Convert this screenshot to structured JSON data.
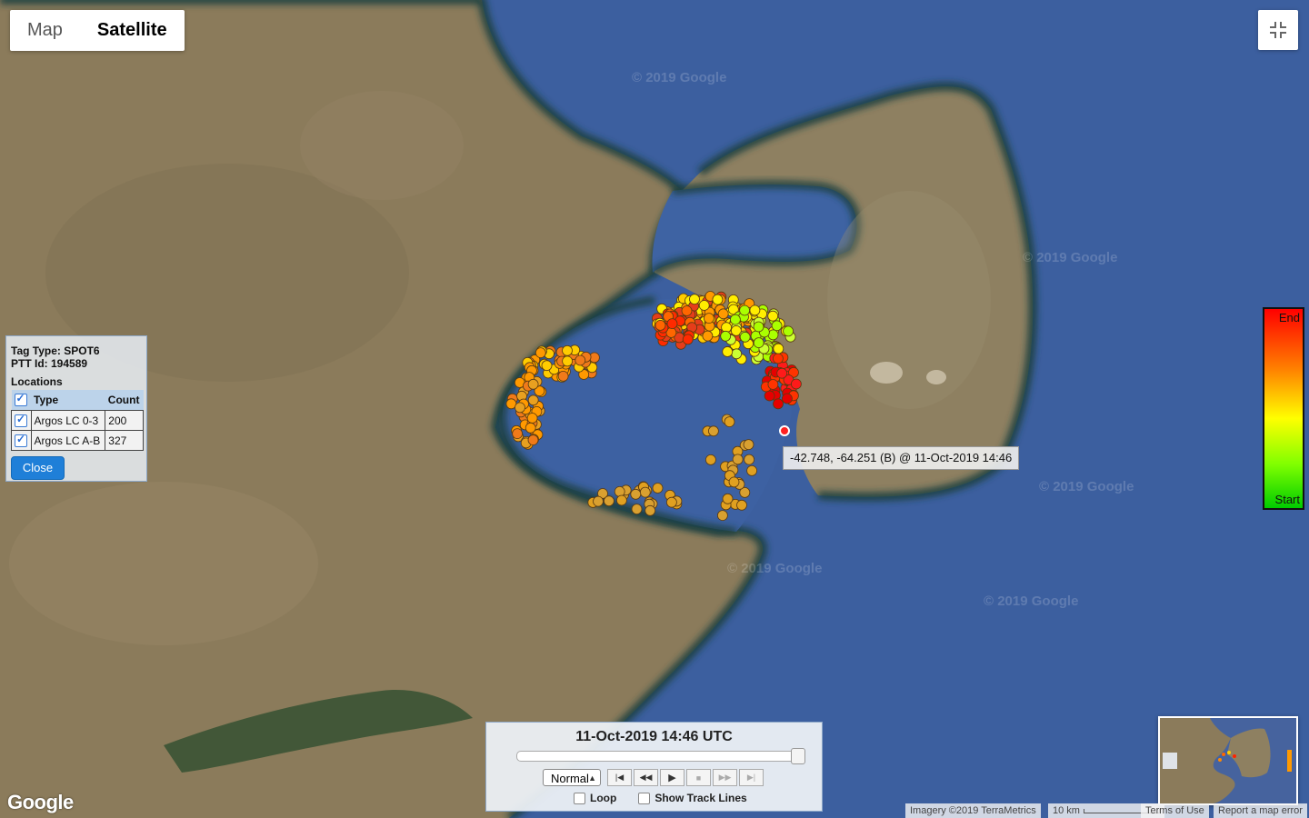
{
  "map_type": {
    "map_label": "Map",
    "satellite_label": "Satellite",
    "selected": "Satellite"
  },
  "watermark": "© 2019 Google",
  "tag_info": {
    "tag_type": "Tag Type: SPOT6",
    "ptt_id": "PTT Id: 194589",
    "locations_label": "Locations",
    "col_type": "Type",
    "col_count": "Count",
    "rows": [
      {
        "type": "Argos LC 0-3",
        "count": "200"
      },
      {
        "type": "Argos LC A-B",
        "count": "327"
      }
    ],
    "close_label": "Close"
  },
  "tooltip": "-42.748, -64.251 (B) @ 11-Oct-2019 14:46",
  "legend": {
    "end_label": "End",
    "start_label": "Start"
  },
  "playback": {
    "time": "11-Oct-2019 14:46 UTC",
    "progress": 1.0,
    "speed": "Normal",
    "loop_label": "Loop",
    "track_lines_label": "Show Track Lines"
  },
  "branding": {
    "logo": "Google",
    "imagery": "Imagery ©2019 TerraMetrics",
    "scale": "10 km",
    "terms": "Terms of Use",
    "report": "Report a map error"
  },
  "colors": {
    "water": "#3b5e9e",
    "land": "#8a7a5c",
    "track_start": "#00cc00",
    "track_mid": "#ffff00",
    "track_end": "#ff0000"
  }
}
